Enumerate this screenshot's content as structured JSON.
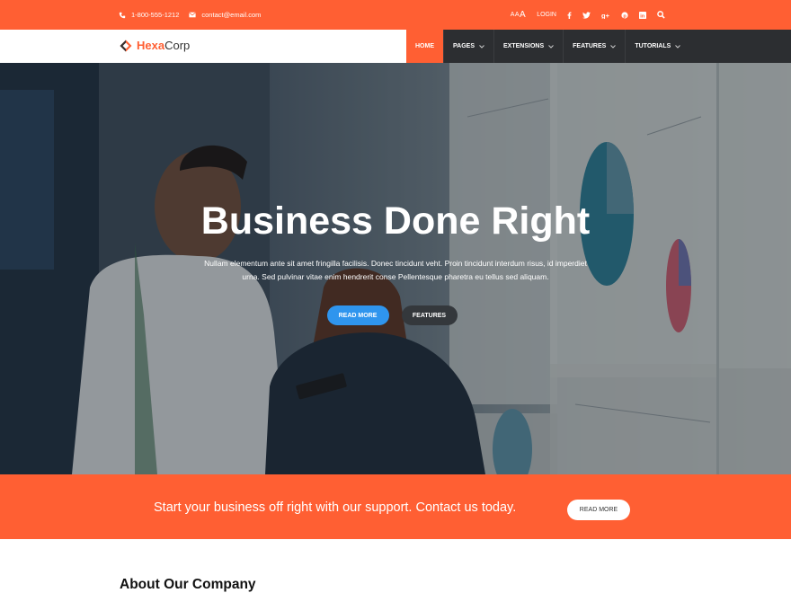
{
  "topbar": {
    "phone": "1-800-555-1212",
    "email": "contact@email.com",
    "font_size_small": "AA",
    "font_size_large": "A",
    "login": "LOGIN",
    "icons": [
      "facebook-icon",
      "twitter-icon",
      "google-plus-icon",
      "pinterest-icon",
      "linkedin-icon",
      "search-icon"
    ]
  },
  "brand": {
    "name_part1": "Hexa",
    "name_part2": "Corp"
  },
  "nav": {
    "items": [
      {
        "label": "HOME"
      },
      {
        "label": "PAGES"
      },
      {
        "label": "EXTENSIONS"
      },
      {
        "label": "FEATURES"
      },
      {
        "label": "TUTORIALS"
      }
    ]
  },
  "hero": {
    "title": "Business Done Right",
    "text_line1": "Nullam elementum ante sit amet fringilla facilisis. Donec tincidunt veht. Proin tincidunt interdum risus, id imperdiet",
    "text_line2": "urna. Sed pulvinar vitae enim hendrerit conse Pellentesque pharetra eu tellus sed aliquam.",
    "btn_primary": "READ MORE",
    "btn_secondary": "FEATURES"
  },
  "cta": {
    "text": "Start your business off right with our support. Contact us today.",
    "button": "READ MORE"
  },
  "about": {
    "title": "About Our Company"
  },
  "colors": {
    "accent": "#ff5f33",
    "dark": "#2c2e31",
    "blue": "#2f95ee"
  }
}
